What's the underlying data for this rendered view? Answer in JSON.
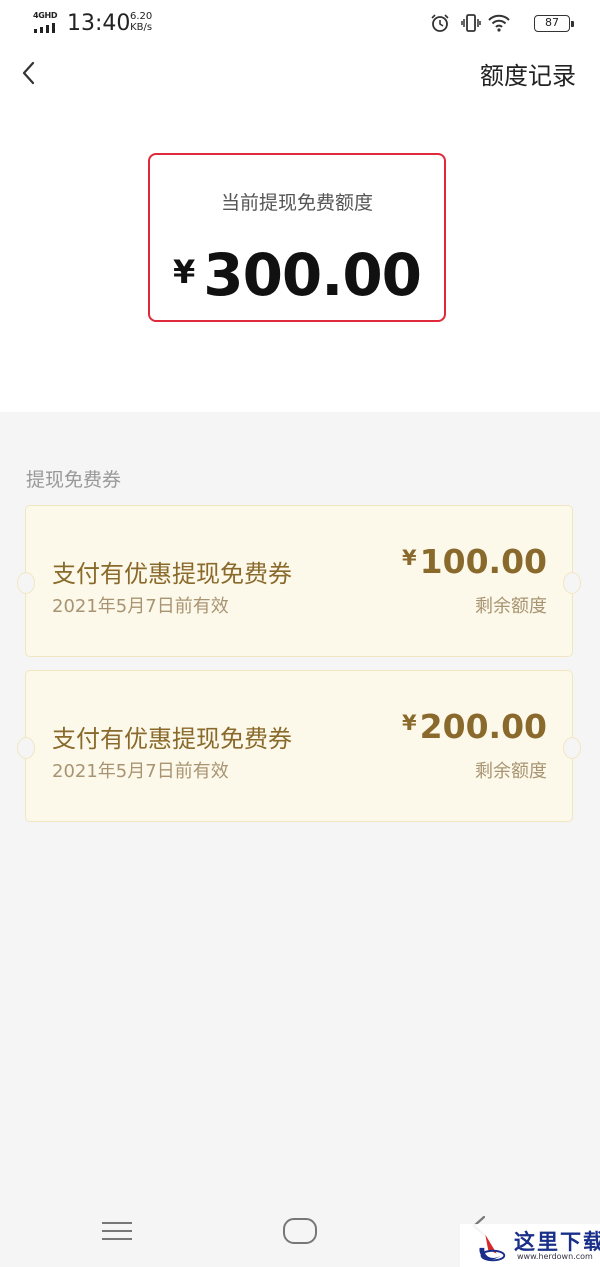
{
  "status_bar": {
    "network": "4GHD",
    "time": "13:40",
    "speed_value": "6.20",
    "speed_unit": "KB/s",
    "battery": "87",
    "icons": [
      "alarm-icon",
      "vibrate-icon",
      "wifi-icon",
      "battery-icon"
    ]
  },
  "nav": {
    "back_icon": "chevron-left-icon",
    "title": "额度记录"
  },
  "balance": {
    "label": "当前提现免费额度",
    "currency": "¥",
    "amount": "300.00"
  },
  "section": {
    "title": "提现免费券"
  },
  "coupons": [
    {
      "name": "支付有优惠提现免费券",
      "expiry": "2021年5月7日前有效",
      "currency": "¥",
      "amount": "100.00",
      "remaining_label": "剩余额度"
    },
    {
      "name": "支付有优惠提现免费券",
      "expiry": "2021年5月7日前有效",
      "currency": "¥",
      "amount": "200.00",
      "remaining_label": "剩余额度"
    }
  ],
  "system_nav": [
    "menu-icon",
    "home-icon",
    "back-icon"
  ],
  "watermark": {
    "text": "这里下载",
    "url": "www.herdown.com"
  },
  "colors": {
    "balance_border": "#e0293b",
    "coupon_text": "#8a6a2c",
    "coupon_bg": "#fdf9ea",
    "watermark_blue": "#1a2f8a",
    "watermark_red": "#d42a2a"
  }
}
